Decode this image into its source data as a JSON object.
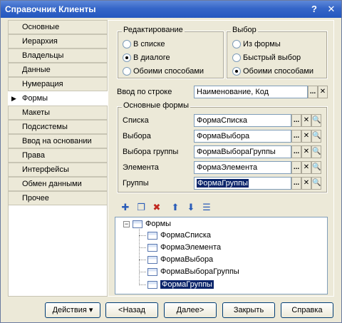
{
  "window": {
    "title": "Справочник Клиенты",
    "help_glyph": "?",
    "close_glyph": "✕"
  },
  "nav": {
    "items": [
      {
        "label": "Основные"
      },
      {
        "label": "Иерархия"
      },
      {
        "label": "Владельцы"
      },
      {
        "label": "Данные"
      },
      {
        "label": "Нумерация"
      },
      {
        "label": "Формы",
        "active": true
      },
      {
        "label": "Макеты"
      },
      {
        "label": "Подсистемы"
      },
      {
        "label": "Ввод на основании"
      },
      {
        "label": "Права"
      },
      {
        "label": "Интерфейсы"
      },
      {
        "label": "Обмен данными"
      },
      {
        "label": "Прочее"
      }
    ]
  },
  "editing": {
    "title": "Редактирование",
    "options": [
      "В списке",
      "В диалоге",
      "Обоими способами"
    ],
    "selected_index": 1
  },
  "selection": {
    "title": "Выбор",
    "options": [
      "Из формы",
      "Быстрый выбор",
      "Обоими способами"
    ],
    "selected_index": 2
  },
  "input_by_line": {
    "label": "Ввод по строке",
    "value": "Наименование, Код"
  },
  "main_forms": {
    "title": "Основные формы",
    "rows": [
      {
        "label": "Списка",
        "value": "ФормаСписка"
      },
      {
        "label": "Выбора",
        "value": "ФормаВыбора"
      },
      {
        "label": "Выбора группы",
        "value": "ФормаВыбораГруппы"
      },
      {
        "label": "Элемента",
        "value": "ФормаЭлемента"
      },
      {
        "label": "Группы",
        "value": "ФормаГруппы",
        "selected": true
      }
    ]
  },
  "field_buttons": {
    "choose": "...",
    "clear": "✕",
    "open": "🔍"
  },
  "tree": {
    "root": "Формы",
    "children": [
      "ФормаСписка",
      "ФормаЭлемента",
      "ФормаВыбора",
      "ФормаВыбораГруппы",
      "ФормаГруппы"
    ],
    "selected_index": 4,
    "expander": "−"
  },
  "toolbar": {
    "add": "✚",
    "copy": "❐",
    "delete": "✖",
    "up": "⬆",
    "down": "⬇",
    "sort": "☰"
  },
  "buttons": {
    "actions": "Действия",
    "actions_arrow": "▾",
    "back": "<Назад",
    "next": "Далее>",
    "close": "Закрыть",
    "help": "Справка"
  },
  "colors": {
    "title_bar": "#3566c8",
    "selection": "#0a246a",
    "dialog_bg": "#ece9d8"
  }
}
